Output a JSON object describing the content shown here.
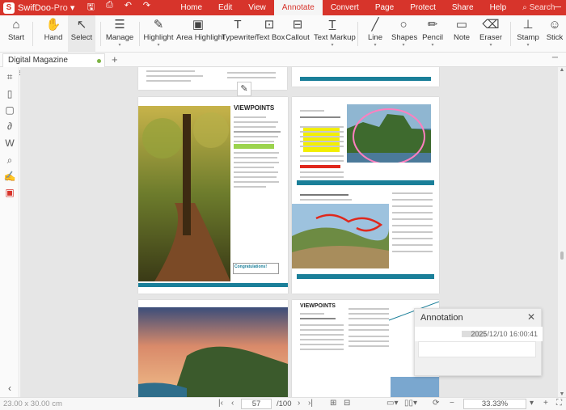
{
  "app": {
    "name": "SwifDoo",
    "edition": "-Pro",
    "edition_dropdown": "▾"
  },
  "menu": {
    "items": [
      "Home",
      "Edit",
      "View",
      "Annotate",
      "Convert",
      "Page",
      "Protect",
      "Share",
      "Help"
    ],
    "active": "Annotate",
    "search_placeholder": "Search"
  },
  "toolbar": {
    "start": "Start",
    "hand": "Hand",
    "select": "Select",
    "manage": "Manage",
    "highlight": "Highlight",
    "area_highlight": "Area Highlight",
    "typewriter": "Typewriter",
    "text_box": "Text Box",
    "callout": "Callout",
    "text_markup": "Text Markup",
    "line": "Line",
    "shapes": "Shapes",
    "pencil": "Pencil",
    "note": "Note",
    "eraser": "Eraser",
    "stamp": "Stamp",
    "sticker": "Stick"
  },
  "tabs": {
    "doc_name": "Digital Magazine Example.pdf *",
    "add": "+"
  },
  "document": {
    "page1_heading": "VIEWPOINTS",
    "page1_box": "Congratulations!",
    "page4_heading": "VIEWPOINTS"
  },
  "annotation": {
    "title": "Annotation",
    "timestamp": "2025/12/10 16:00:41"
  },
  "status": {
    "page_size": "23.00 x 30.00 cm",
    "current_page": "57",
    "total_pages": "/100",
    "zoom": "33.33%"
  },
  "colors": {
    "brand": "#d7342b",
    "teal": "#1a7f99",
    "highlight_yellow": "#f3ef00",
    "highlight_green": "#9bd34d",
    "pink_ink": "#ff7fbf",
    "red_ink": "#e0281c"
  }
}
